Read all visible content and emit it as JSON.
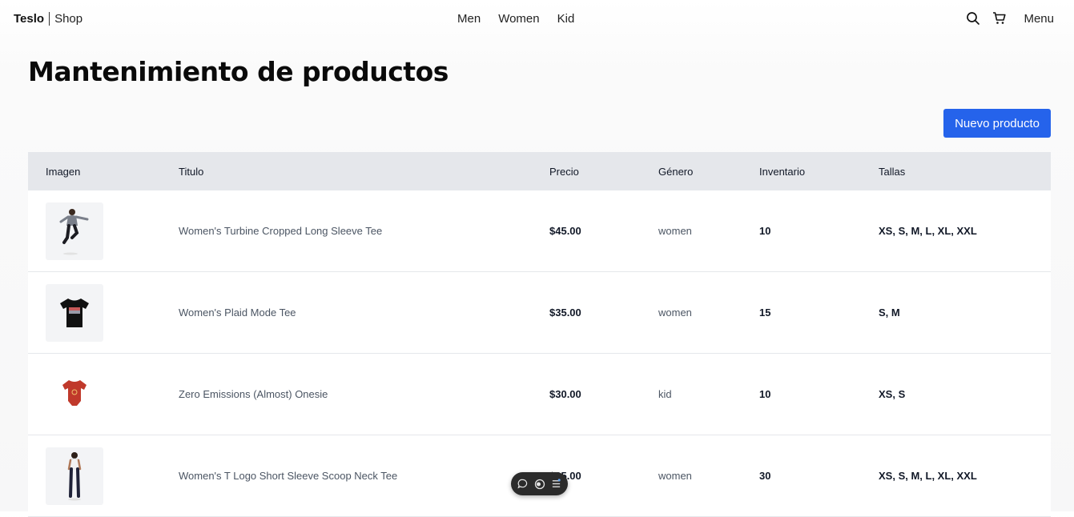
{
  "brand": {
    "name": "Teslo",
    "sub": "Shop"
  },
  "nav": {
    "links": [
      "Men",
      "Women",
      "Kid"
    ],
    "menu_label": "Menu"
  },
  "icons": {
    "search": "search-icon",
    "cart": "cart-icon"
  },
  "page": {
    "title": "Mantenimiento de productos",
    "new_button": "Nuevo producto"
  },
  "colors": {
    "accent": "#2563eb",
    "header_bg": "#e5e7eb"
  },
  "table": {
    "headers": [
      "Imagen",
      "Titulo",
      "Precio",
      "Género",
      "Inventario",
      "Tallas"
    ],
    "rows": [
      {
        "title": "Women's Turbine Cropped Long Sleeve Tee",
        "price": "$45.00",
        "gender": "women",
        "stock": "10",
        "sizes": "XS, S, M, L, XL, XXL",
        "image": "woman-model-photo"
      },
      {
        "title": "Women's Plaid Mode Tee",
        "price": "$35.00",
        "gender": "women",
        "stock": "15",
        "sizes": "S, M",
        "image": "black-tee-photo"
      },
      {
        "title": "Zero Emissions (Almost) Onesie",
        "price": "$30.00",
        "gender": "kid",
        "stock": "10",
        "sizes": "XS, S",
        "image": "red-onesie-photo"
      },
      {
        "title": "Women's T Logo Short Sleeve Scoop Neck Tee",
        "price": "$35.00",
        "gender": "women",
        "stock": "30",
        "sizes": "XS, S, M, L, XL, XXL",
        "image": "woman-model-photo"
      }
    ]
  },
  "floating_toolbar": {
    "icons": [
      "comment-icon",
      "toggle-icon",
      "list-icon"
    ]
  }
}
